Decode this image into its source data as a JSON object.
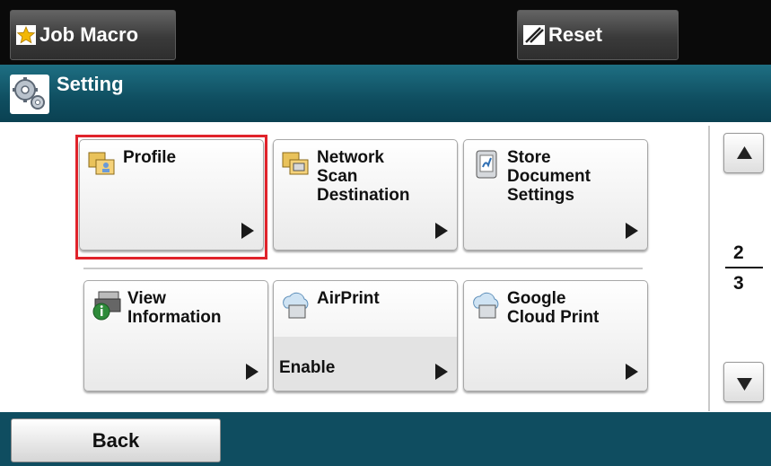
{
  "header": {
    "job_macro_label": "Job Macro",
    "reset_label": "Reset"
  },
  "title_bar": {
    "title": "Setting"
  },
  "tiles": [
    {
      "label": "Profile",
      "icon": "profile-folder-icon",
      "selected": true
    },
    {
      "label": "Network\nScan\nDestination",
      "icon": "network-folder-icon"
    },
    {
      "label": "Store\nDocument\nSettings",
      "icon": "store-document-icon"
    },
    {
      "label": "View\nInformation",
      "icon": "printer-info-icon"
    },
    {
      "label": "AirPrint",
      "icon": "cloud-print-icon",
      "status": "Enable"
    },
    {
      "label": "Google\nCloud Print",
      "icon": "cloud-print-icon"
    }
  ],
  "pager": {
    "current": "2",
    "total": "3"
  },
  "footer": {
    "back_label": "Back"
  },
  "colors": {
    "header_bg": "#0a0a0a",
    "title_bg": "#0f4e60",
    "selection": "#e0232b"
  }
}
